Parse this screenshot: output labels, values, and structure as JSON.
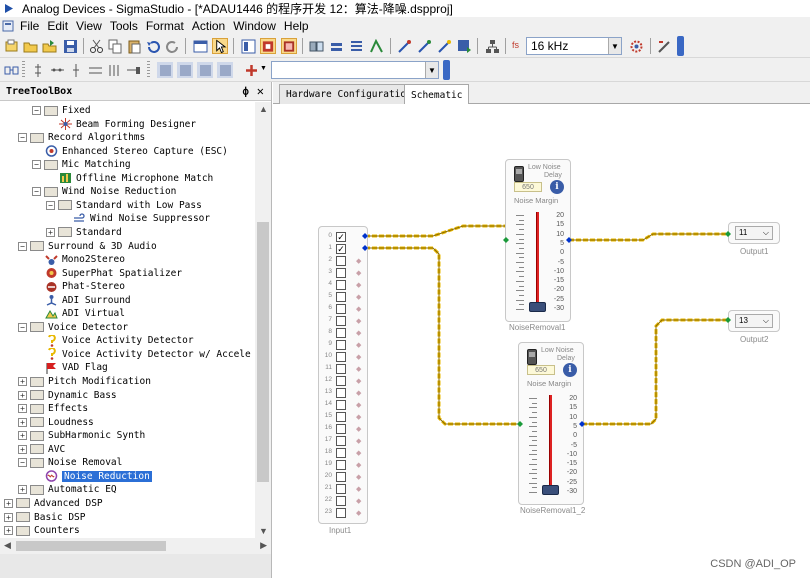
{
  "titlebar": {
    "title": "Analog Devices - SigmaStudio - [*ADAU1446 的程序开发 12：算法-降噪.dspproj]"
  },
  "menu": {
    "items": [
      "File",
      "Edit",
      "View",
      "Tools",
      "Format",
      "Action",
      "Window",
      "Help"
    ]
  },
  "toolbar": {
    "sample_rate_label": "fs",
    "sample_rate_value": "16 kHz",
    "toolbar2_combo_value": ""
  },
  "toolbox": {
    "title": "TreeToolBox",
    "pin": "ф",
    "close": "✕",
    "nodes": [
      {
        "label": "Fixed",
        "kind": "folder",
        "exp": "−",
        "level": 3
      },
      {
        "label": "Beam Forming Designer",
        "kind": "leaf",
        "icon": "beamform-icon",
        "level": 4
      },
      {
        "label": "Record Algorithms",
        "kind": "folder",
        "exp": "−",
        "level": 2
      },
      {
        "label": "Enhanced Stereo Capture (ESC)",
        "kind": "leaf",
        "icon": "stereo-capture-icon",
        "level": 3
      },
      {
        "label": "Mic Matching",
        "kind": "folder",
        "exp": "−",
        "level": 3
      },
      {
        "label": "Offline Microphone Match",
        "kind": "leaf",
        "icon": "mic-match-icon",
        "level": 4
      },
      {
        "label": "Wind Noise Reduction",
        "kind": "folder",
        "exp": "−",
        "level": 3
      },
      {
        "label": "Standard with Low Pass",
        "kind": "folder",
        "exp": "−",
        "level": 4
      },
      {
        "label": "Wind Noise Suppressor",
        "kind": "leaf",
        "icon": "wind-icon",
        "level": 5
      },
      {
        "label": "Standard",
        "kind": "folder",
        "exp": "+",
        "level": 4
      },
      {
        "label": "Surround & 3D Audio",
        "kind": "folder",
        "exp": "−",
        "level": 2
      },
      {
        "label": "Mono2Stereo",
        "kind": "leaf",
        "icon": "mono2stereo-icon",
        "level": 3
      },
      {
        "label": "SuperPhat Spatializer",
        "kind": "leaf",
        "icon": "spatializer-icon",
        "level": 3
      },
      {
        "label": "Phat-Stereo",
        "kind": "leaf",
        "icon": "phat-stereo-icon",
        "level": 3
      },
      {
        "label": "ADI Surround",
        "kind": "leaf",
        "icon": "surround-icon",
        "level": 3
      },
      {
        "label": "ADI Virtual",
        "kind": "leaf",
        "icon": "virtual-icon",
        "level": 3
      },
      {
        "label": "Voice Detector",
        "kind": "folder",
        "exp": "−",
        "level": 2
      },
      {
        "label": "Voice Activity Detector",
        "kind": "leaf",
        "icon": "vad-icon",
        "level": 3
      },
      {
        "label": "Voice Activity Detector w/ Accele",
        "kind": "leaf",
        "icon": "vad-accel-icon",
        "level": 3
      },
      {
        "label": "VAD Flag",
        "kind": "leaf",
        "icon": "flag-icon",
        "level": 3
      },
      {
        "label": "Pitch Modification",
        "kind": "folder",
        "exp": "+",
        "level": 2
      },
      {
        "label": "Dynamic Bass",
        "kind": "folder",
        "exp": "+",
        "level": 2
      },
      {
        "label": "Effects",
        "kind": "folder",
        "exp": "+",
        "level": 2
      },
      {
        "label": "Loudness",
        "kind": "folder",
        "exp": "+",
        "level": 2
      },
      {
        "label": "SubHarmonic Synth",
        "kind": "folder",
        "exp": "+",
        "level": 2
      },
      {
        "label": "AVC",
        "kind": "folder",
        "exp": "+",
        "level": 2
      },
      {
        "label": "Noise Removal",
        "kind": "folder",
        "exp": "−",
        "level": 2
      },
      {
        "label": "Noise Reduction",
        "kind": "leaf",
        "icon": "noise-reduction-icon",
        "level": 3,
        "selected": true
      },
      {
        "label": "Automatic EQ",
        "kind": "folder",
        "exp": "+",
        "level": 2
      },
      {
        "label": "Advanced DSP",
        "kind": "folder",
        "exp": "+",
        "level": 1
      },
      {
        "label": "Basic DSP",
        "kind": "folder",
        "exp": "+",
        "level": 1
      },
      {
        "label": "Counters",
        "kind": "folder",
        "exp": "+",
        "level": 1
      }
    ]
  },
  "tabs": [
    {
      "label": "Hardware Configuration",
      "active": false
    },
    {
      "label": "Schematic",
      "active": true
    }
  ],
  "schematic": {
    "input": {
      "label": "Input1",
      "channels": [
        "0",
        "1",
        "2",
        "3",
        "4",
        "5",
        "6",
        "7",
        "8",
        "9",
        "10",
        "11",
        "12",
        "13",
        "14",
        "15",
        "16",
        "17",
        "18",
        "19",
        "20",
        "21",
        "22",
        "23"
      ],
      "checked": [
        0,
        1
      ]
    },
    "noise_blocks": [
      {
        "name": "NoiseRemoval1",
        "title": "Low Noise",
        "subtitle": "Delay",
        "value": "650",
        "margin_label": "Noise Margin",
        "scale": [
          "20",
          "15",
          "10",
          "5",
          "0",
          "-5",
          "-10",
          "-15",
          "-20",
          "-25",
          "-30"
        ]
      },
      {
        "name": "NoiseRemoval1_2",
        "title": "Low Noise",
        "subtitle": "Delay",
        "value": "650",
        "margin_label": "Noise Margin",
        "scale": [
          "20",
          "15",
          "10",
          "5",
          "0",
          "-5",
          "-10",
          "-15",
          "-20",
          "-25",
          "-30"
        ]
      }
    ],
    "outputs": [
      {
        "name": "Output1",
        "value": "11"
      },
      {
        "name": "Output2",
        "value": "13"
      }
    ]
  },
  "watermark": "CSDN @ADI_OP",
  "colors": {
    "wire": "#e8b800",
    "selection": "#2b6fd6",
    "pin_blue": "#0033cc",
    "pin_green": "#1a9a3a"
  }
}
